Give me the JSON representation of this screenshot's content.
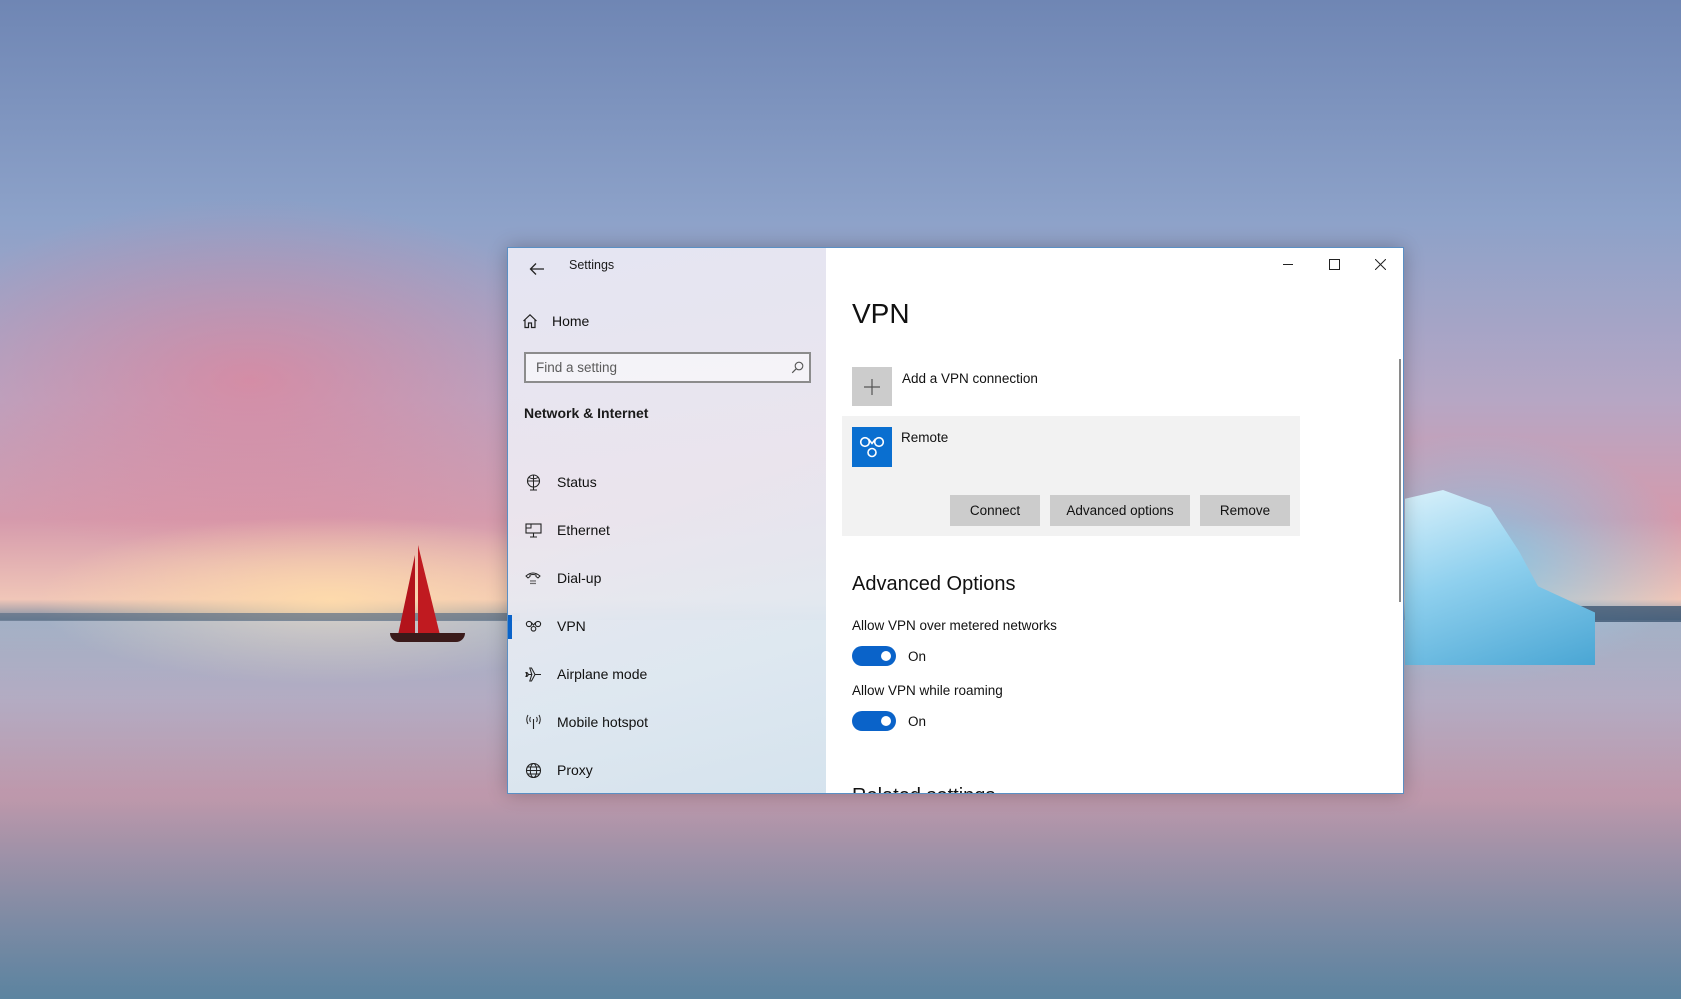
{
  "window": {
    "title": "Settings",
    "caption_buttons": {
      "minimize": "minimize-icon",
      "maximize": "maximize-icon",
      "close": "close-icon"
    }
  },
  "sidebar": {
    "home_label": "Home",
    "search": {
      "placeholder": "Find a setting",
      "value": ""
    },
    "section_title": "Network & Internet",
    "items": [
      {
        "label": "Status",
        "icon": "globe-monitor-icon",
        "selected": false
      },
      {
        "label": "Ethernet",
        "icon": "ethernet-icon",
        "selected": false
      },
      {
        "label": "Dial-up",
        "icon": "dial-up-phone-icon",
        "selected": false
      },
      {
        "label": "VPN",
        "icon": "vpn-icon",
        "selected": true
      },
      {
        "label": "Airplane mode",
        "icon": "airplane-icon",
        "selected": false
      },
      {
        "label": "Mobile hotspot",
        "icon": "hotspot-icon",
        "selected": false
      },
      {
        "label": "Proxy",
        "icon": "globe-icon",
        "selected": false
      }
    ]
  },
  "main": {
    "page_title": "VPN",
    "add_connection_label": "Add a VPN connection",
    "connection": {
      "name": "Remote",
      "buttons": {
        "connect": "Connect",
        "advanced": "Advanced options",
        "remove": "Remove"
      }
    },
    "advanced_options": {
      "title": "Advanced Options",
      "options": [
        {
          "label": "Allow VPN over metered networks",
          "state": "On",
          "enabled": true
        },
        {
          "label": "Allow VPN while roaming",
          "state": "On",
          "enabled": true
        }
      ]
    },
    "related_settings_title": "Related settings"
  },
  "colors": {
    "accent": "#0a63c9",
    "vpn_tile": "#0a6fd0",
    "button_bg": "#cccccc",
    "card_bg": "#f2f2f2"
  }
}
